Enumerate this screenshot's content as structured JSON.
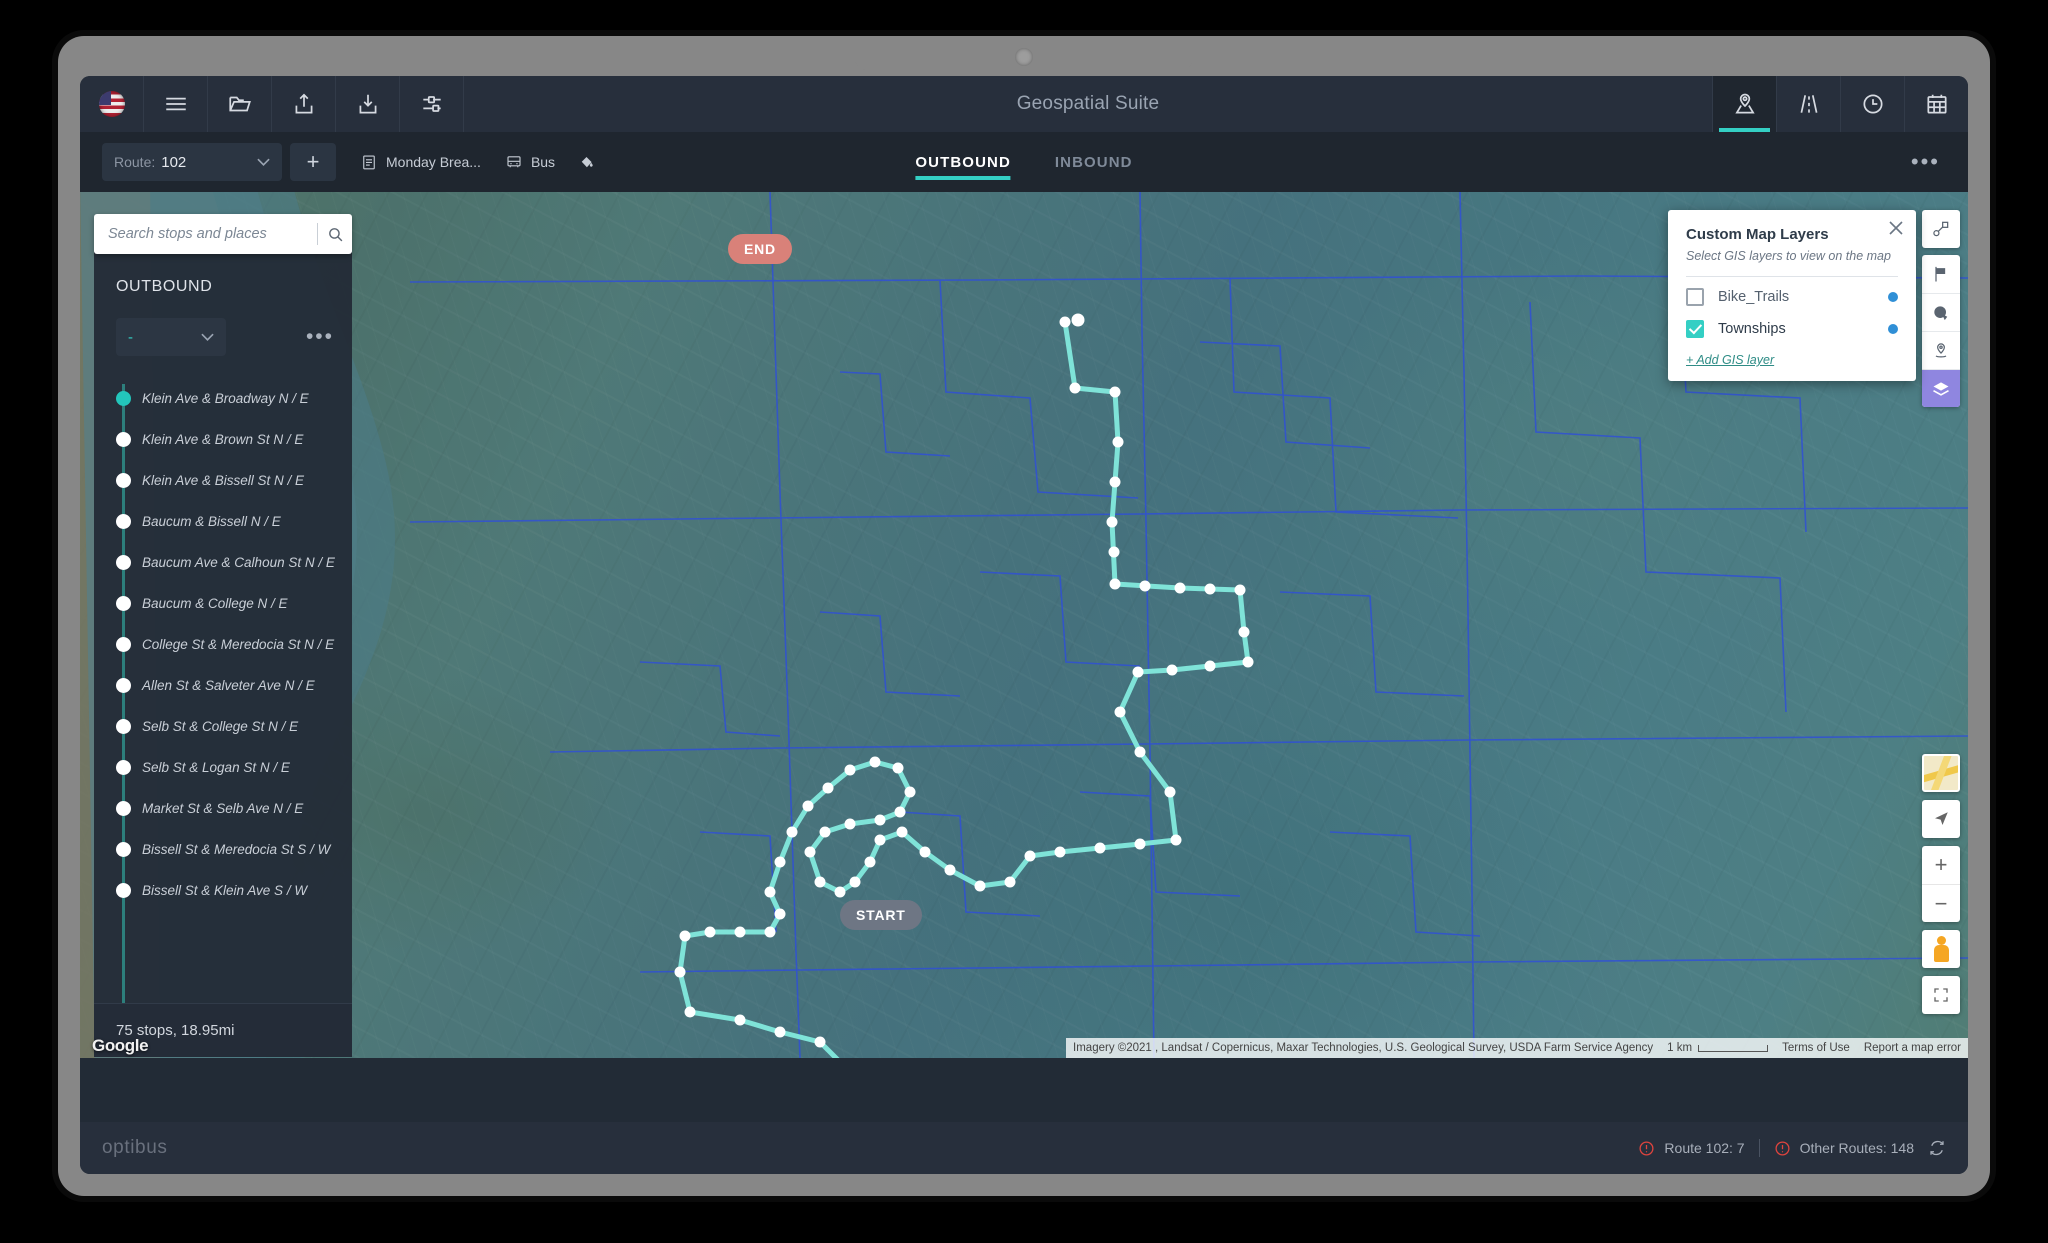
{
  "app": {
    "title": "Geospatial Suite",
    "logo": "optibus"
  },
  "toolbar": {
    "icons": [
      {
        "name": "flag-us-icon",
        "label": "US"
      },
      {
        "name": "hamburger-menu-icon",
        "label": "Menu"
      },
      {
        "name": "open-folder-icon",
        "label": "Open"
      },
      {
        "name": "upload-share-icon",
        "label": "Export"
      },
      {
        "name": "download-icon",
        "label": "Import"
      },
      {
        "name": "settings-sliders-icon",
        "label": "Settings"
      }
    ],
    "tabs": [
      {
        "name": "map-pin-tab",
        "label": "Map",
        "active": true
      },
      {
        "name": "road-tab",
        "label": "Road",
        "active": false
      },
      {
        "name": "clock-tab",
        "label": "Schedule",
        "active": false
      },
      {
        "name": "calendar-tab",
        "label": "Calendar",
        "active": false
      }
    ]
  },
  "routebar": {
    "route_label": "Route:",
    "route_value": "102",
    "add_label": "+",
    "pattern_chip": "Monday Brea...",
    "vehicle_chip": "Bus",
    "paint_icon": "paint-fill-icon",
    "more_label": "•••",
    "direction_tabs": [
      {
        "label": "OUTBOUND",
        "active": true
      },
      {
        "label": "INBOUND",
        "active": false
      }
    ]
  },
  "search": {
    "placeholder": "Search stops and places",
    "value": ""
  },
  "stops_panel": {
    "heading": "OUTBOUND",
    "select_value": "-",
    "more_label": "•••",
    "footer": "75 stops, 18.95mi",
    "stops": [
      "Klein Ave & Broadway N / E",
      "Klein Ave & Brown St N / E",
      "Klein Ave & Bissell St N / E",
      "Baucum & Bissell N / E",
      "Baucum Ave & Calhoun St N / E",
      "Baucum & College N / E",
      "College St & Meredocia St N / E",
      "Allen St & Salveter Ave N / E",
      "Selb St & College St N / E",
      "Selb St & Logan St N / E",
      "Market St & Selb Ave N / E",
      "Bissell St & Meredocia St S / W",
      "Bissell St & Klein Ave S / W"
    ]
  },
  "layers_panel": {
    "title": "Custom Map Layers",
    "subtitle": "Select GIS layers to view on the map",
    "close_label": "×",
    "add_link_plus": "+ ",
    "add_link": "Add GIS layer",
    "layers": [
      {
        "name": "Bike_Trails",
        "checked": false,
        "color": "#2f8fd6"
      },
      {
        "name": "Townships",
        "checked": true,
        "color": "#2f8fd6"
      }
    ]
  },
  "map": {
    "start_label": "START",
    "end_label": "END",
    "start_color": "#6e7684",
    "end_color": "#d98179",
    "route_color": "#7fe3d8",
    "attribution": "Imagery ©2021 , Landsat / Copernicus, Maxar Technologies, U.S. Geological Survey, USDA Farm Service Agency",
    "scale_label": "1 km",
    "terms_label": "Terms of Use",
    "report_label": "Report a map error",
    "google_logo": "Google",
    "tool_rail": [
      {
        "name": "measure-nodes-icon",
        "active": false
      },
      {
        "name": "flag-icon",
        "active": false
      },
      {
        "name": "pie-chart-icon",
        "active": false
      },
      {
        "name": "place-pin-icon",
        "active": false
      },
      {
        "name": "layers-icon",
        "active": true
      }
    ],
    "controls": [
      {
        "name": "map-type-thumbnail"
      },
      {
        "name": "navigation-arrow-icon"
      },
      {
        "name": "zoom-in-button",
        "label": "+"
      },
      {
        "name": "zoom-out-button",
        "label": "−"
      },
      {
        "name": "pegman-streetview-icon"
      },
      {
        "name": "fullscreen-icon"
      }
    ]
  },
  "status": {
    "route_issues": "Route 102: 7",
    "other_issues": "Other Routes: 148",
    "refresh_icon": "refresh-icon",
    "warn_color": "#e0443e"
  }
}
